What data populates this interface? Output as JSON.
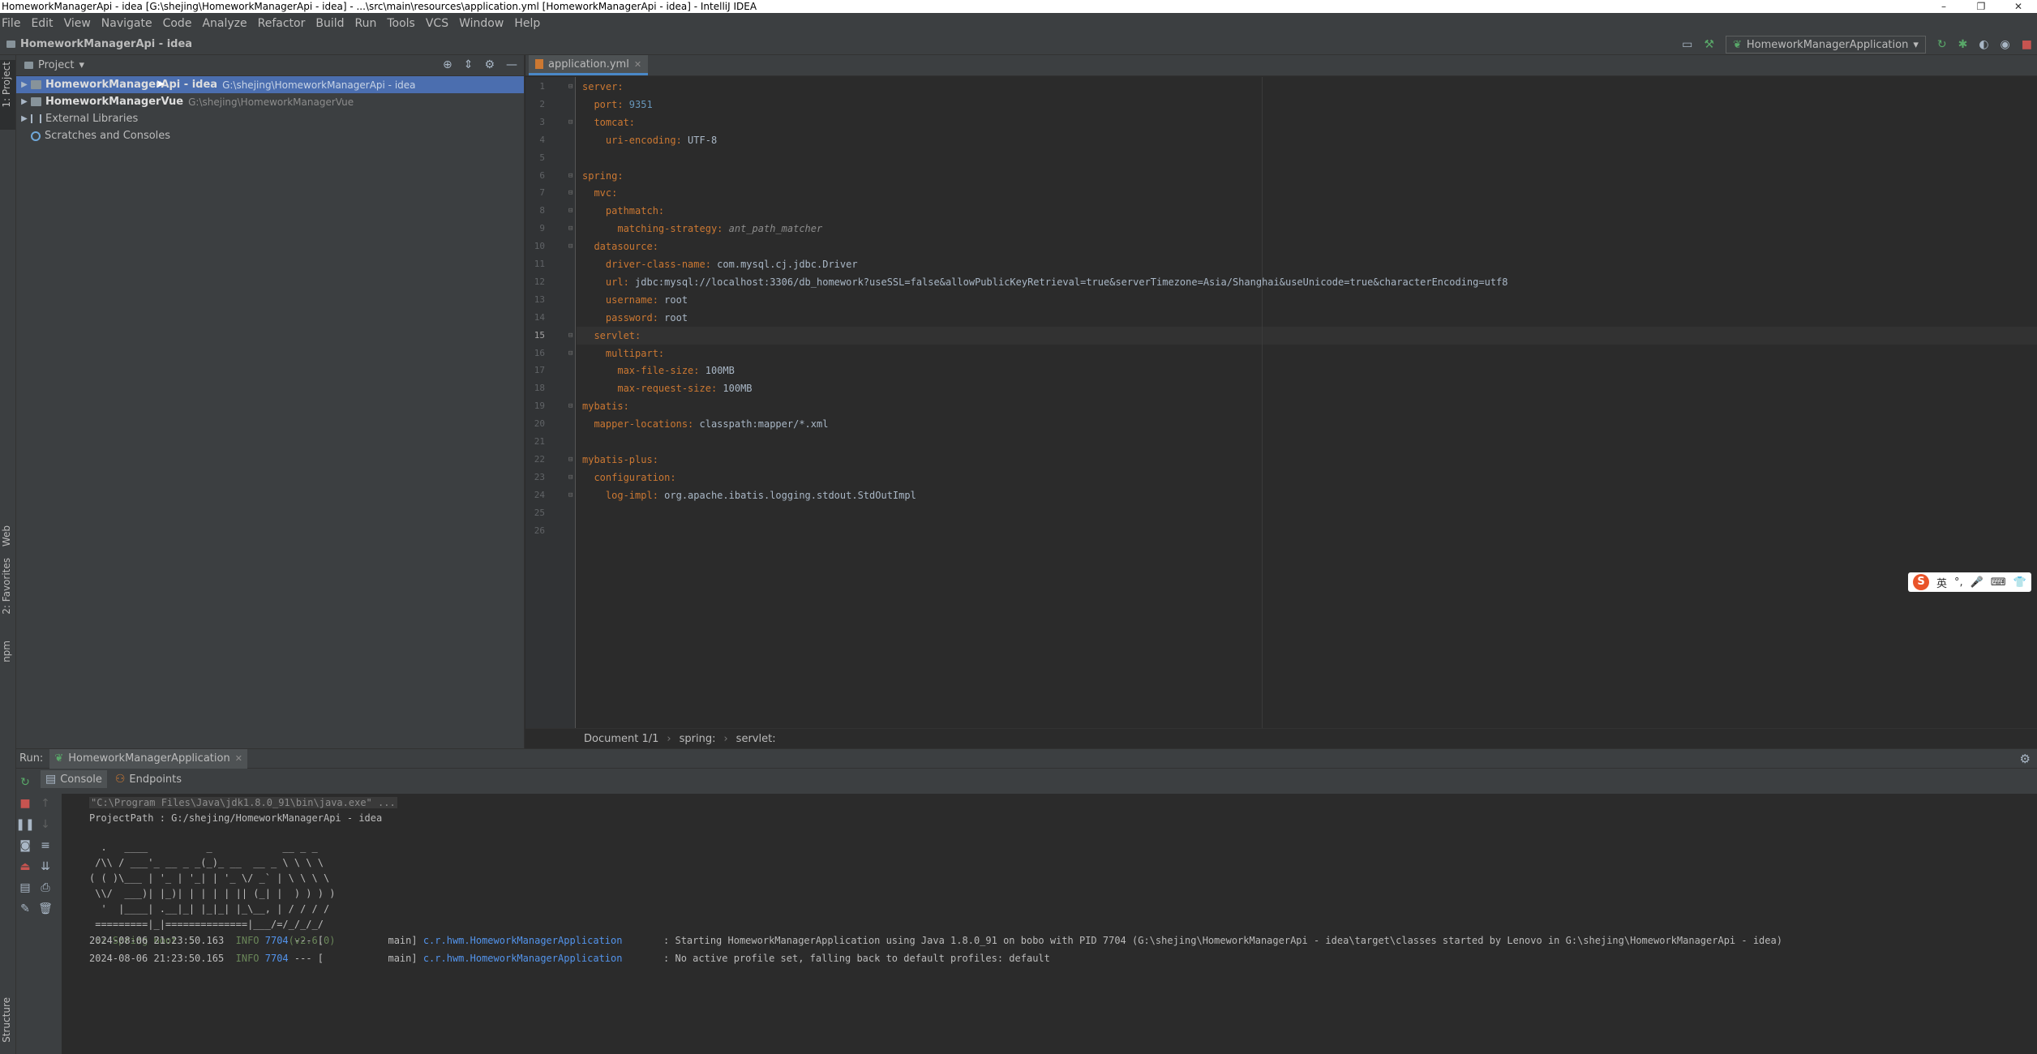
{
  "window": {
    "title": "HomeworkManagerApi - idea [G:\\shejing\\HomeworkManagerApi - idea] - ...\\src\\main\\resources\\application.yml [HomeworkManagerApi - idea] - IntelliJ IDEA",
    "controls": [
      "–",
      "❐",
      "✕"
    ]
  },
  "menu": [
    "File",
    "Edit",
    "View",
    "Navigate",
    "Code",
    "Analyze",
    "Refactor",
    "Build",
    "Run",
    "Tools",
    "VCS",
    "Window",
    "Help"
  ],
  "navbar": {
    "project_name": "HomeworkManagerApi - idea",
    "run_config": "HomeworkManagerApplication"
  },
  "left_strip": {
    "project_label": "1: Project",
    "web_label": "Web",
    "favorites_label": "2: Favorites",
    "npm_label": "npm",
    "structure_label": "Structure"
  },
  "project_panel": {
    "title": "Project",
    "tree": [
      {
        "name": "HomeworkManagerApi - idea",
        "path": "G:\\shejing\\HomeworkManagerApi - idea",
        "selected": true
      },
      {
        "name": "HomeworkManagerVue",
        "path": "G:\\shejing\\HomeworkManagerVue",
        "selected": false
      },
      {
        "name": "External Libraries",
        "path": "",
        "selected": false
      },
      {
        "name": "Scratches and Consoles",
        "path": "",
        "selected": false
      }
    ]
  },
  "editor": {
    "tab_label": "application.yml",
    "current_line": 15,
    "lines": [
      {
        "indent": "",
        "key": "server:",
        "val": "",
        "type": ""
      },
      {
        "indent": "  ",
        "key": "port:",
        "val": " 9351",
        "type": "n"
      },
      {
        "indent": "  ",
        "key": "tomcat:",
        "val": "",
        "type": ""
      },
      {
        "indent": "    ",
        "key": "uri-encoding:",
        "val": " UTF-8",
        "type": "v"
      },
      {
        "indent": "",
        "key": "",
        "val": "",
        "type": ""
      },
      {
        "indent": "",
        "key": "spring:",
        "val": "",
        "type": ""
      },
      {
        "indent": "  ",
        "key": "mvc:",
        "val": "",
        "type": ""
      },
      {
        "indent": "    ",
        "key": "pathmatch:",
        "val": "",
        "type": ""
      },
      {
        "indent": "      ",
        "key": "matching-strategy:",
        "val": " ant_path_matcher",
        "type": "i"
      },
      {
        "indent": "  ",
        "key": "datasource:",
        "val": "",
        "type": ""
      },
      {
        "indent": "    ",
        "key": "driver-class-name:",
        "val": " com.mysql.cj.jdbc.Driver",
        "type": "v"
      },
      {
        "indent": "    ",
        "key": "url:",
        "val": " jdbc:mysql://localhost:3306/db_homework?useSSL=false&allowPublicKeyRetrieval=true&serverTimezone=Asia/Shanghai&useUnicode=true&characterEncoding=utf8",
        "type": "v"
      },
      {
        "indent": "    ",
        "key": "username:",
        "val": " root",
        "type": "v"
      },
      {
        "indent": "    ",
        "key": "password:",
        "val": " root",
        "type": "v"
      },
      {
        "indent": "  ",
        "key": "servlet:",
        "val": "",
        "type": ""
      },
      {
        "indent": "    ",
        "key": "multipart:",
        "val": "",
        "type": ""
      },
      {
        "indent": "      ",
        "key": "max-file-size:",
        "val": " 100MB",
        "type": "v"
      },
      {
        "indent": "      ",
        "key": "max-request-size:",
        "val": " 100MB",
        "type": "v"
      },
      {
        "indent": "",
        "key": "mybatis:",
        "val": "",
        "type": ""
      },
      {
        "indent": "  ",
        "key": "mapper-locations:",
        "val": " classpath:mapper/*.xml",
        "type": "v"
      },
      {
        "indent": "",
        "key": "",
        "val": "",
        "type": ""
      },
      {
        "indent": "",
        "key": "mybatis-plus:",
        "val": "",
        "type": ""
      },
      {
        "indent": "  ",
        "key": "configuration:",
        "val": "",
        "type": ""
      },
      {
        "indent": "    ",
        "key": "log-impl:",
        "val": " org.apache.ibatis.logging.stdout.StdOutImpl",
        "type": "v"
      },
      {
        "indent": "",
        "key": "",
        "val": "",
        "type": ""
      },
      {
        "indent": "",
        "key": "",
        "val": "",
        "type": ""
      }
    ],
    "fold_lines": [
      1,
      3,
      6,
      7,
      8,
      9,
      10,
      15,
      16,
      19,
      22,
      23,
      24
    ],
    "breadcrumb": [
      "Document 1/1",
      "spring:",
      "servlet:"
    ]
  },
  "ime": {
    "logo": "S",
    "lang": "英",
    "punct": "°,",
    "mic": "🎤",
    "keyboard": "⌨",
    "skin": "👕"
  },
  "run_panel": {
    "label": "Run:",
    "tab": "HomeworkManagerApplication",
    "subtabs": [
      "Console",
      "Endpoints"
    ],
    "console": {
      "cmd": "\"C:\\Program Files\\Java\\jdk1.8.0_91\\bin\\java.exe\" ...",
      "project_path": "ProjectPath : G:/shejing/HomeworkManagerApi - idea",
      "banner": [
        "  .   ____          _            __ _ _",
        " /\\\\ / ___'_ __ _ _(_)_ __  __ _ \\ \\ \\ \\",
        "( ( )\\___ | '_ | '_| | '_ \\/ _` | \\ \\ \\ \\",
        " \\\\/  ___)| |_)| | | | | || (_| |  ) ) ) )",
        "  '  |____| .__|_| |_|_| |_\\__, | / / / /",
        " =========|_|==============|___/=/_/_/_/"
      ],
      "spring_boot": " :: Spring Boot ::                (v2.6.0)",
      "logs": [
        {
          "time": "2024-08-06 21:23:50.163",
          "level": "INFO",
          "pid": "7704",
          "sep": "--- [",
          "thread": "           main]",
          "logger": "c.r.hwm.HomeworkManagerApplication",
          "msg": " : Starting HomeworkManagerApplication using Java 1.8.0_91 on bobo with PID 7704 (G:\\shejing\\HomeworkManagerApi - idea\\target\\classes started by Lenovo in G:\\shejing\\HomeworkManagerApi - idea)"
        },
        {
          "time": "2024-08-06 21:23:50.165",
          "level": "INFO",
          "pid": "7704",
          "sep": "--- [",
          "thread": "           main]",
          "logger": "c.r.hwm.HomeworkManagerApplication",
          "msg": " : No active profile set, falling back to default profiles: default"
        }
      ]
    }
  }
}
